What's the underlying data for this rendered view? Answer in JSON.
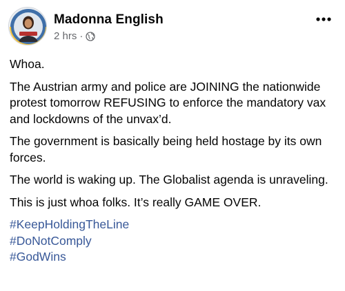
{
  "post": {
    "author": "Madonna English",
    "timestamp": "2 hrs",
    "separator": "·",
    "privacy_icon": "globe-icon",
    "more_icon": "more-options-icon",
    "paragraphs": [
      "Whoa.",
      "The Austrian army and police are JOINING the nationwide protest tomorrow REFUSING to enforce the mandatory vax and lockdowns of the unvax’d.",
      "The government is basically being held hostage by its own forces.",
      "The world is waking up. The Globalist agenda is unraveling.",
      "This is just whoa folks. It’s really GAME OVER."
    ],
    "hashtags": [
      "#KeepHoldingTheLine",
      "#DoNotComply",
      "#GodWins"
    ]
  },
  "colors": {
    "text": "#050505",
    "secondary_text": "#65676b",
    "hashtag": "#385898"
  }
}
